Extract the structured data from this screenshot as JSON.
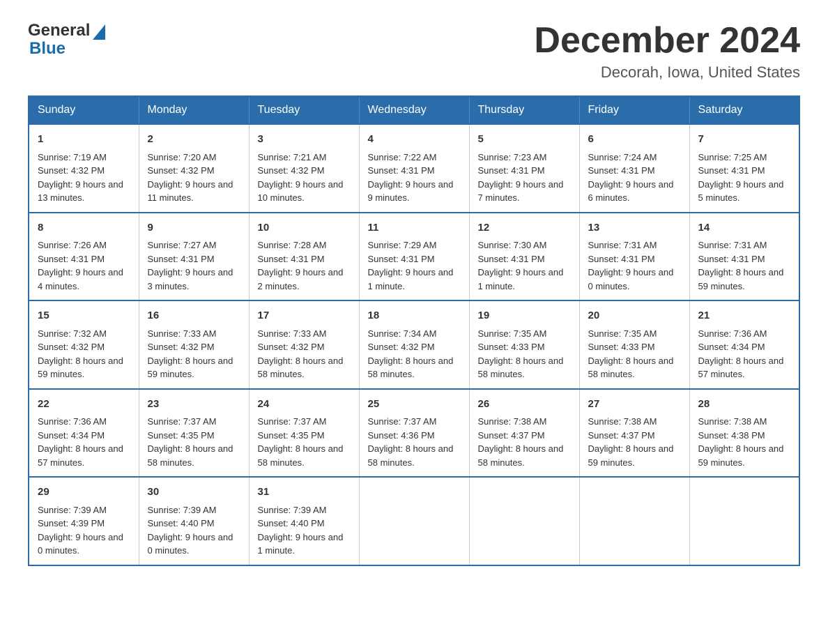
{
  "logo": {
    "text_general": "General",
    "text_blue": "Blue"
  },
  "title": {
    "month_year": "December 2024",
    "location": "Decorah, Iowa, United States"
  },
  "days_of_week": [
    "Sunday",
    "Monday",
    "Tuesday",
    "Wednesday",
    "Thursday",
    "Friday",
    "Saturday"
  ],
  "weeks": [
    [
      {
        "day": "1",
        "sunrise": "7:19 AM",
        "sunset": "4:32 PM",
        "daylight": "9 hours and 13 minutes."
      },
      {
        "day": "2",
        "sunrise": "7:20 AM",
        "sunset": "4:32 PM",
        "daylight": "9 hours and 11 minutes."
      },
      {
        "day": "3",
        "sunrise": "7:21 AM",
        "sunset": "4:32 PM",
        "daylight": "9 hours and 10 minutes."
      },
      {
        "day": "4",
        "sunrise": "7:22 AM",
        "sunset": "4:31 PM",
        "daylight": "9 hours and 9 minutes."
      },
      {
        "day": "5",
        "sunrise": "7:23 AM",
        "sunset": "4:31 PM",
        "daylight": "9 hours and 7 minutes."
      },
      {
        "day": "6",
        "sunrise": "7:24 AM",
        "sunset": "4:31 PM",
        "daylight": "9 hours and 6 minutes."
      },
      {
        "day": "7",
        "sunrise": "7:25 AM",
        "sunset": "4:31 PM",
        "daylight": "9 hours and 5 minutes."
      }
    ],
    [
      {
        "day": "8",
        "sunrise": "7:26 AM",
        "sunset": "4:31 PM",
        "daylight": "9 hours and 4 minutes."
      },
      {
        "day": "9",
        "sunrise": "7:27 AM",
        "sunset": "4:31 PM",
        "daylight": "9 hours and 3 minutes."
      },
      {
        "day": "10",
        "sunrise": "7:28 AM",
        "sunset": "4:31 PM",
        "daylight": "9 hours and 2 minutes."
      },
      {
        "day": "11",
        "sunrise": "7:29 AM",
        "sunset": "4:31 PM",
        "daylight": "9 hours and 1 minute."
      },
      {
        "day": "12",
        "sunrise": "7:30 AM",
        "sunset": "4:31 PM",
        "daylight": "9 hours and 1 minute."
      },
      {
        "day": "13",
        "sunrise": "7:31 AM",
        "sunset": "4:31 PM",
        "daylight": "9 hours and 0 minutes."
      },
      {
        "day": "14",
        "sunrise": "7:31 AM",
        "sunset": "4:31 PM",
        "daylight": "8 hours and 59 minutes."
      }
    ],
    [
      {
        "day": "15",
        "sunrise": "7:32 AM",
        "sunset": "4:32 PM",
        "daylight": "8 hours and 59 minutes."
      },
      {
        "day": "16",
        "sunrise": "7:33 AM",
        "sunset": "4:32 PM",
        "daylight": "8 hours and 59 minutes."
      },
      {
        "day": "17",
        "sunrise": "7:33 AM",
        "sunset": "4:32 PM",
        "daylight": "8 hours and 58 minutes."
      },
      {
        "day": "18",
        "sunrise": "7:34 AM",
        "sunset": "4:32 PM",
        "daylight": "8 hours and 58 minutes."
      },
      {
        "day": "19",
        "sunrise": "7:35 AM",
        "sunset": "4:33 PM",
        "daylight": "8 hours and 58 minutes."
      },
      {
        "day": "20",
        "sunrise": "7:35 AM",
        "sunset": "4:33 PM",
        "daylight": "8 hours and 58 minutes."
      },
      {
        "day": "21",
        "sunrise": "7:36 AM",
        "sunset": "4:34 PM",
        "daylight": "8 hours and 57 minutes."
      }
    ],
    [
      {
        "day": "22",
        "sunrise": "7:36 AM",
        "sunset": "4:34 PM",
        "daylight": "8 hours and 57 minutes."
      },
      {
        "day": "23",
        "sunrise": "7:37 AM",
        "sunset": "4:35 PM",
        "daylight": "8 hours and 58 minutes."
      },
      {
        "day": "24",
        "sunrise": "7:37 AM",
        "sunset": "4:35 PM",
        "daylight": "8 hours and 58 minutes."
      },
      {
        "day": "25",
        "sunrise": "7:37 AM",
        "sunset": "4:36 PM",
        "daylight": "8 hours and 58 minutes."
      },
      {
        "day": "26",
        "sunrise": "7:38 AM",
        "sunset": "4:37 PM",
        "daylight": "8 hours and 58 minutes."
      },
      {
        "day": "27",
        "sunrise": "7:38 AM",
        "sunset": "4:37 PM",
        "daylight": "8 hours and 59 minutes."
      },
      {
        "day": "28",
        "sunrise": "7:38 AM",
        "sunset": "4:38 PM",
        "daylight": "8 hours and 59 minutes."
      }
    ],
    [
      {
        "day": "29",
        "sunrise": "7:39 AM",
        "sunset": "4:39 PM",
        "daylight": "9 hours and 0 minutes."
      },
      {
        "day": "30",
        "sunrise": "7:39 AM",
        "sunset": "4:40 PM",
        "daylight": "9 hours and 0 minutes."
      },
      {
        "day": "31",
        "sunrise": "7:39 AM",
        "sunset": "4:40 PM",
        "daylight": "9 hours and 1 minute."
      },
      null,
      null,
      null,
      null
    ]
  ],
  "labels": {
    "sunrise": "Sunrise:",
    "sunset": "Sunset:",
    "daylight": "Daylight:"
  }
}
